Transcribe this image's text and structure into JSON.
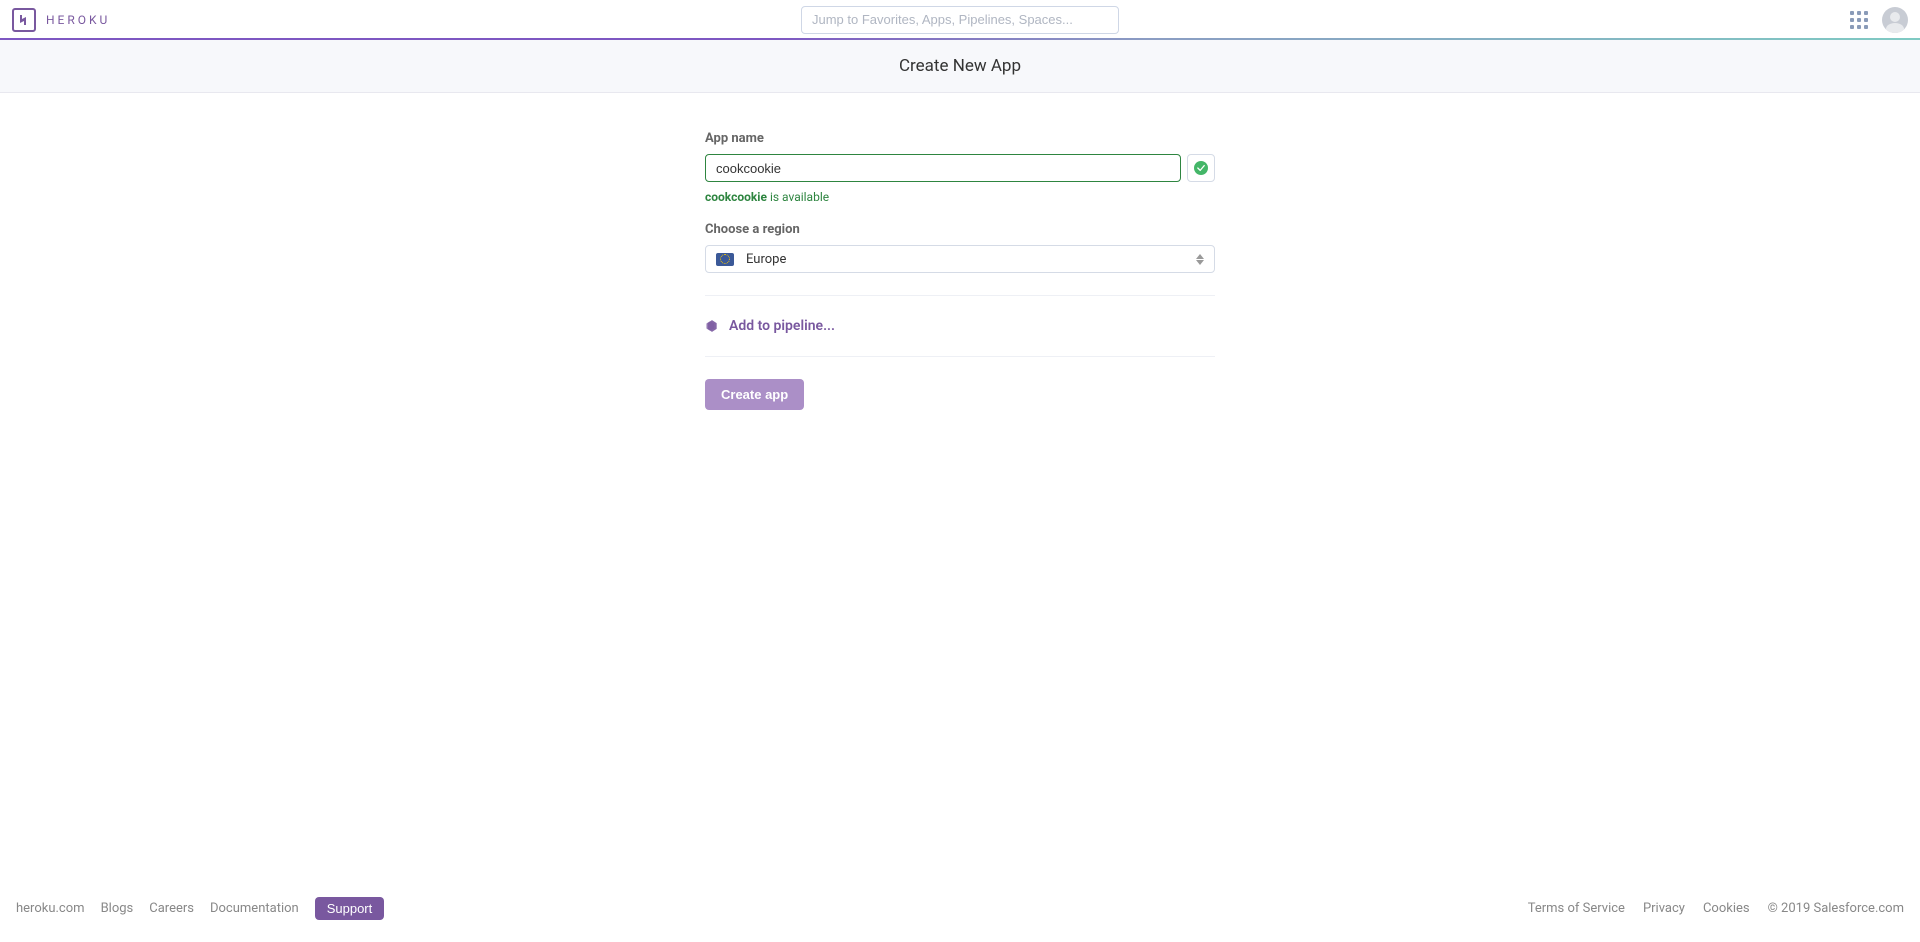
{
  "brand": "HEROKU",
  "search": {
    "placeholder": "Jump to Favorites, Apps, Pipelines, Spaces..."
  },
  "page": {
    "title": "Create New App"
  },
  "form": {
    "appNameLabel": "App name",
    "appNameValue": "cookcookie",
    "availabilityName": "cookcookie",
    "availabilitySuffix": " is available",
    "regionLabel": "Choose a region",
    "regionValue": "Europe",
    "pipelineLink": "Add to pipeline...",
    "submitLabel": "Create app"
  },
  "footer": {
    "left": [
      "heroku.com",
      "Blogs",
      "Careers",
      "Documentation"
    ],
    "support": "Support",
    "right": [
      "Terms of Service",
      "Privacy",
      "Cookies"
    ],
    "copyright": "© 2019 Salesforce.com"
  }
}
